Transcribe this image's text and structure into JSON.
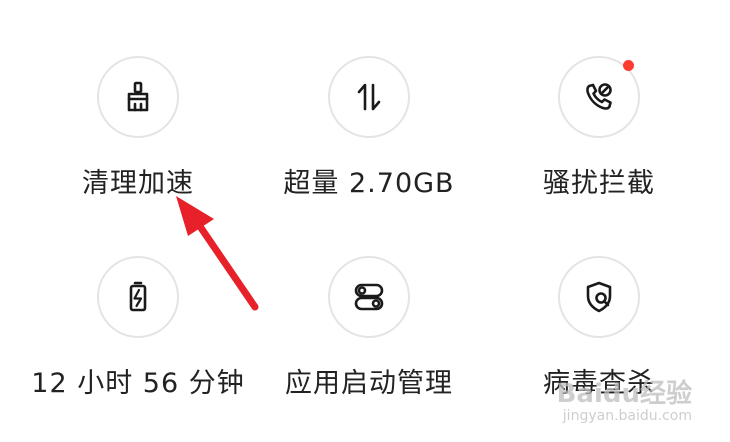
{
  "colors": {
    "notification_dot": "#ff3b30",
    "annotation_arrow": "#e8202a"
  },
  "tiles": [
    {
      "label": "清理加速",
      "icon": "broom-icon"
    },
    {
      "label": "超量 2.70GB",
      "icon": "data-transfer-icon"
    },
    {
      "label": "骚扰拦截",
      "icon": "blocked-call-icon",
      "badge": "red-dot"
    },
    {
      "label": "12 小时 56 分钟",
      "icon": "battery-charging-icon"
    },
    {
      "label": "应用启动管理",
      "icon": "toggle-switches-icon"
    },
    {
      "label": "病毒查杀",
      "icon": "shield-search-icon"
    }
  ],
  "watermark": {
    "text": "Baidu经验",
    "url": "jingyan.baidu.com"
  }
}
